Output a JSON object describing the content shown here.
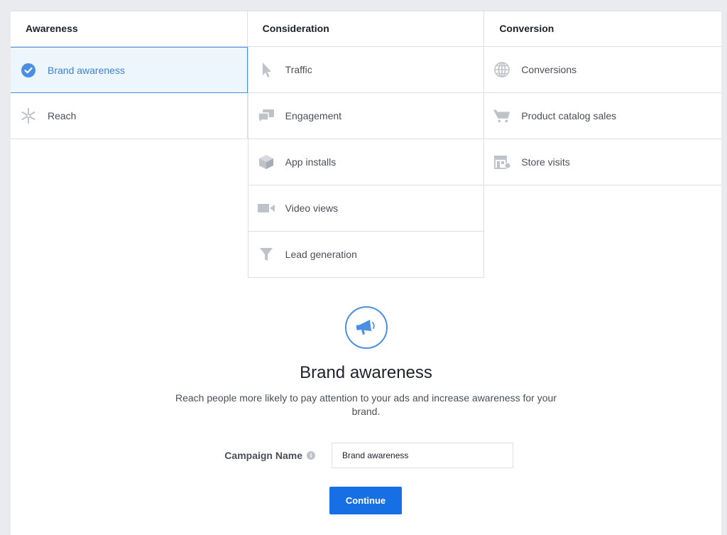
{
  "columns": [
    {
      "header": "Awareness",
      "items": [
        {
          "label": "Brand awareness",
          "icon": "check-circle-icon",
          "selected": true
        },
        {
          "label": "Reach",
          "icon": "reach-icon",
          "selected": false
        }
      ]
    },
    {
      "header": "Consideration",
      "items": [
        {
          "label": "Traffic",
          "icon": "cursor-icon"
        },
        {
          "label": "Engagement",
          "icon": "chat-bubbles-icon"
        },
        {
          "label": "App installs",
          "icon": "box-icon"
        },
        {
          "label": "Video views",
          "icon": "video-camera-icon"
        },
        {
          "label": "Lead generation",
          "icon": "funnel-icon"
        }
      ]
    },
    {
      "header": "Conversion",
      "items": [
        {
          "label": "Conversions",
          "icon": "globe-icon"
        },
        {
          "label": "Product catalog sales",
          "icon": "cart-icon"
        },
        {
          "label": "Store visits",
          "icon": "store-icon"
        }
      ]
    }
  ],
  "detail": {
    "icon": "megaphone-icon",
    "title": "Brand awareness",
    "description": "Reach people more likely to pay attention to your ads and increase awareness for your brand."
  },
  "campaign": {
    "label": "Campaign Name",
    "info_icon": "info-icon",
    "value": "Brand awareness"
  },
  "continue_label": "Continue",
  "colors": {
    "accent": "#4a90e2",
    "selected_bg": "#edf5fd",
    "button": "#166fe5"
  }
}
